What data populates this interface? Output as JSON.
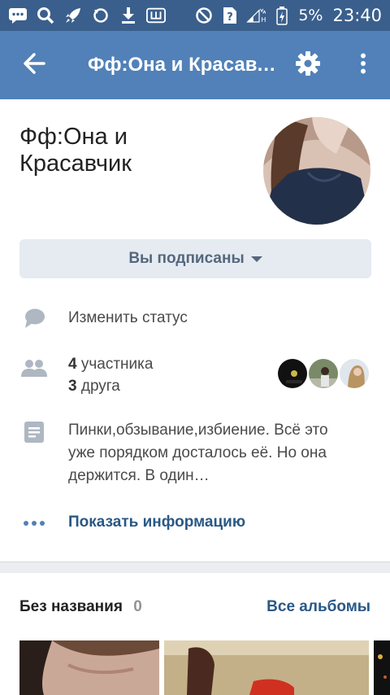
{
  "status_bar": {
    "battery": "5%",
    "time": "23:40",
    "icons": [
      "message-icon",
      "search-icon",
      "rocket-icon",
      "refresh-icon",
      "download-icon",
      "app-icon",
      "dnd-icon",
      "sim-icon",
      "signal-icon",
      "battery-icon"
    ]
  },
  "toolbar": {
    "title": "Фф:Она и Красавчик",
    "back_icon": "back-arrow-icon",
    "settings_icon": "gear-icon",
    "more_icon": "more-vertical-icon"
  },
  "group": {
    "name": "Фф:Она и Красавчик",
    "subscribed_label": "Вы подписаны"
  },
  "rows": {
    "status_label": "Изменить статус",
    "members_count": "4",
    "members_word": "участника",
    "friends_count": "3",
    "friends_word": "друга",
    "description": "Пинки,обзывание,избиение. Всё это уже порядком досталось её. Но она держится. В один…",
    "show_info": "Показать информацию"
  },
  "albums": {
    "title": "Без названия",
    "count": "0",
    "all_label": "Все альбомы"
  },
  "colors": {
    "status_bar": "#3a5f8c",
    "toolbar": "#5181b8",
    "link": "#2a5885",
    "button_bg": "#e5ebf1"
  }
}
